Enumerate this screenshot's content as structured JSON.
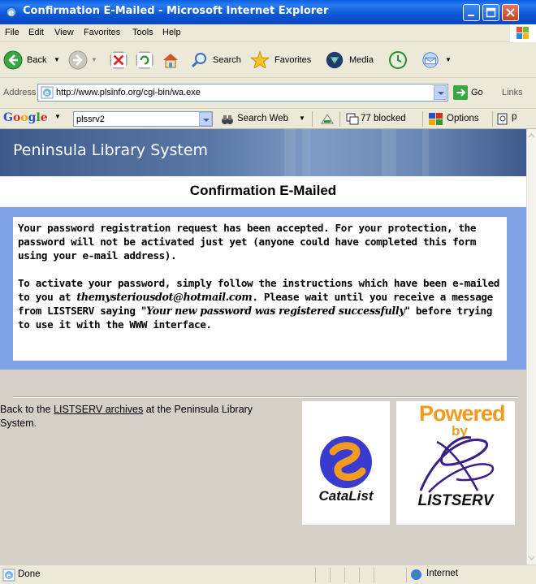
{
  "window": {
    "title": "Confirmation E-Mailed - Microsoft Internet Explorer"
  },
  "menu": [
    "File",
    "Edit",
    "View",
    "Favorites",
    "Tools",
    "Help"
  ],
  "toolbar": {
    "back_label": "Back",
    "search_label": "Search",
    "favorites_label": "Favorites",
    "media_label": "Media"
  },
  "address": {
    "label": "Address",
    "url": "http://www.plsinfo.org/cgi-bin/wa.exe",
    "go_label": "Go",
    "links_label": "Links"
  },
  "google_bar": {
    "logo_text": "Google",
    "query": "plssrv2",
    "search_web_label": "Search Web",
    "blocked_label": "77 blocked",
    "options_label": "Options",
    "trailing_label": "p"
  },
  "page": {
    "site_title": "Peninsula Library System",
    "heading": "Confirmation E-Mailed",
    "para1": "Your password registration request has been accepted. For your protection, the password will not be activated just yet (anyone could have completed this form using your e-mail address).",
    "para2_a": "To activate your password, simply follow the instructions which have been e-mailed to you at ",
    "email": "themysteriousdot@hotmail.com",
    "para2_b": ". Please wait until you receive a message from LISTSERV saying ",
    "quote": "\"Your new password was registered successfully\"",
    "para2_c": " before trying to use it with the WWW interface.",
    "footer_before": "Back to the ",
    "footer_link": "LISTSERV archives",
    "footer_after": " at the Peninsula Library System.",
    "catalist_logo_text": "CataList",
    "powered_text": "Powered",
    "by_text": "by",
    "listserv_logo_text": "LISTSERV"
  },
  "status": {
    "text": "Done",
    "zone": "Internet"
  },
  "colors": {
    "titlebar": "#0a47c0",
    "chrome": "#ece9d8",
    "header_band": "#5a78a6",
    "message_frame": "#7fa1e6",
    "content_bg": "#d4d0c8",
    "powered_orange": "#f39a1d",
    "listserv_purple": "#3a1f8c"
  }
}
